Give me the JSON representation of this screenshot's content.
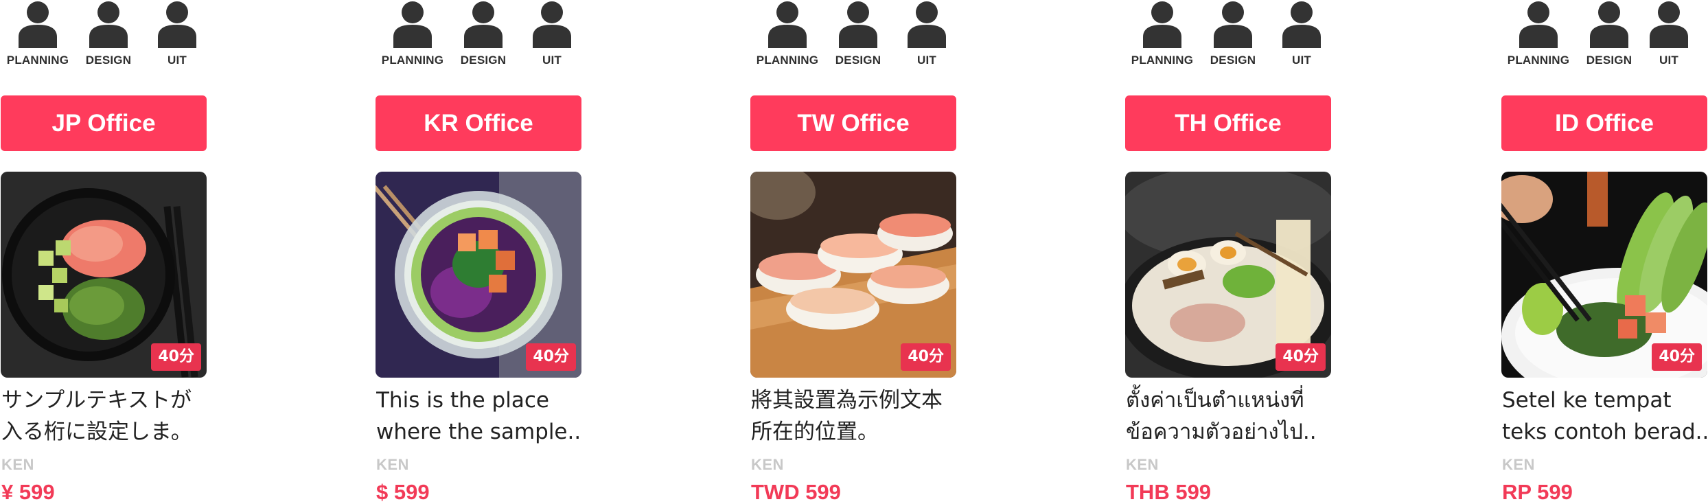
{
  "colors": {
    "accent": "#ff3b5c",
    "badge": "#e8334f",
    "price": "#f23a57",
    "author": "#c8c8c8"
  },
  "team_roles": [
    "PLANNING",
    "DESIGN",
    "UIT"
  ],
  "offices": [
    {
      "button": "JP Office",
      "badge": "40分",
      "title_lines": [
        "サンプルテキストが",
        "入る桁に設定しま。"
      ],
      "author": "KEN",
      "price": "¥ 599",
      "dish": "poke-bowl"
    },
    {
      "button": "KR Office",
      "badge": "40分",
      "title_lines": [
        "This is the place",
        "where the sample.."
      ],
      "author": "KEN",
      "price": "$ 599",
      "dish": "salad-bowl"
    },
    {
      "button": "TW Office",
      "badge": "40分",
      "title_lines": [
        "將其設置為示例文本",
        "所在的位置。"
      ],
      "author": "KEN",
      "price": "TWD 599",
      "dish": "sushi"
    },
    {
      "button": "TH Office",
      "badge": "40分",
      "title_lines": [
        "ตั้งค่าเป็นตำแหน่งที่",
        "ข้อความตัวอย่างไป.."
      ],
      "author": "KEN",
      "price": "THB 599",
      "dish": "ramen"
    },
    {
      "button": "ID Office",
      "badge": "40分",
      "title_lines": [
        "Setel ke tempat",
        "teks contoh berad.."
      ],
      "author": "KEN",
      "price": "RP 599",
      "dish": "avocado-bowl"
    }
  ]
}
